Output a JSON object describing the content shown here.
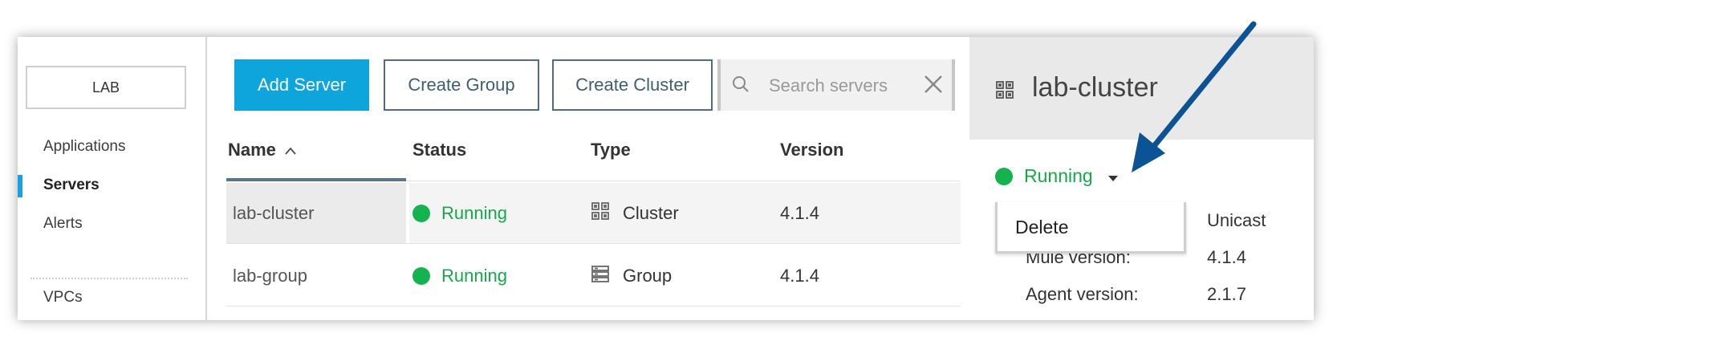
{
  "sidebar": {
    "environment": "LAB",
    "items": [
      {
        "label": "Applications"
      },
      {
        "label": "Servers"
      },
      {
        "label": "Alerts"
      }
    ],
    "secondary_items": [
      {
        "label": "VPCs"
      }
    ]
  },
  "toolbar": {
    "add_server": "Add Server",
    "create_group": "Create Group",
    "create_cluster": "Create Cluster",
    "search_placeholder": "Search servers"
  },
  "table": {
    "columns": [
      "Name",
      "Status",
      "Type",
      "Version"
    ],
    "sort_indicator": "^",
    "rows": [
      {
        "name": "lab-cluster",
        "status": "Running",
        "type": "Cluster",
        "version": "4.1.4"
      },
      {
        "name": "lab-group",
        "status": "Running",
        "type": "Group",
        "version": "4.1.4"
      }
    ]
  },
  "detail": {
    "title": "lab-cluster",
    "status": "Running",
    "menu_items": [
      {
        "label": "Delete"
      }
    ],
    "multicast_value": "Unicast",
    "fields": [
      {
        "label": "Mule version:",
        "value": "4.1.4"
      },
      {
        "label": "Agent version:",
        "value": "2.1.7"
      }
    ]
  },
  "colors": {
    "primary": "#0ea5dc",
    "running": "#14b350",
    "annotation_arrow": "#0b5394"
  }
}
